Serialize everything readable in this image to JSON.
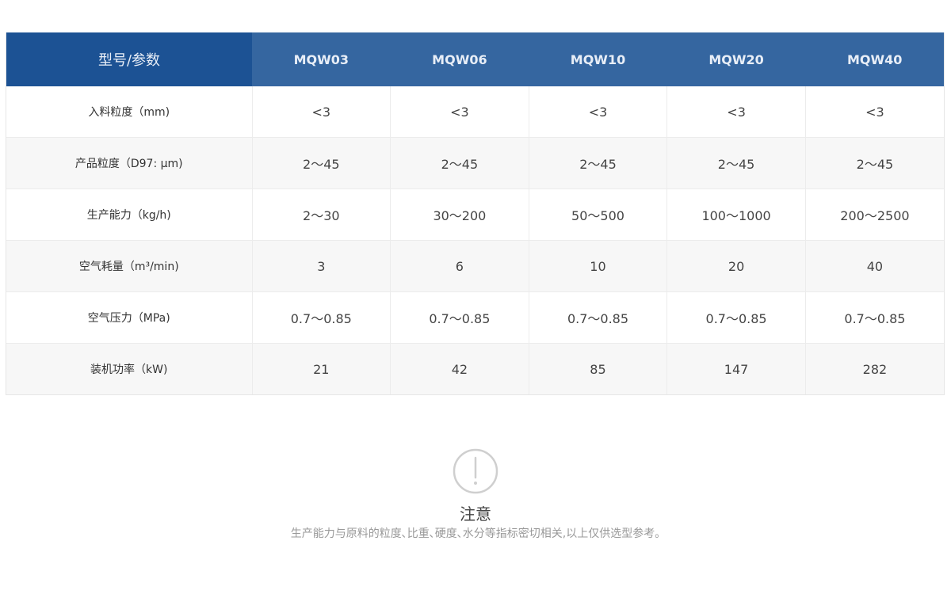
{
  "table": {
    "header_label": "型号/参数",
    "models": [
      "MQW03",
      "MQW06",
      "MQW10",
      "MQW20",
      "MQW40"
    ],
    "rows": [
      {
        "label": "入料粒度（mm)",
        "values": [
          "<3",
          "<3",
          "<3",
          "<3",
          "<3"
        ]
      },
      {
        "label": "产品粒度（D97: μm)",
        "values": [
          "2～45",
          "2～45",
          "2～45",
          "2～45",
          "2～45"
        ]
      },
      {
        "label": "生产能力（kg/h)",
        "values": [
          "2～30",
          "30～200",
          "50～500",
          "100～1000",
          "200～2500"
        ]
      },
      {
        "label": "空气耗量（m³/min)",
        "values": [
          "3",
          "6",
          "10",
          "20",
          "40"
        ]
      },
      {
        "label": "空气压力（MPa)",
        "values": [
          "0.7～0.85",
          "0.7～0.85",
          "0.7～0.85",
          "0.7～0.85",
          "0.7～0.85"
        ]
      },
      {
        "label": "装机功率（kW)",
        "values": [
          "21",
          "42",
          "85",
          "147",
          "282"
        ]
      }
    ]
  },
  "note": {
    "icon": "exclamation-circle-icon",
    "title": "注意",
    "text": "生产能力与原料的粒度､比重､硬度､水分等指标密切相关,以上仅供选型参考｡"
  },
  "colors": {
    "header_first": "#1c5294",
    "header": "#3566a0",
    "row_alt": "#f7f7f7"
  }
}
